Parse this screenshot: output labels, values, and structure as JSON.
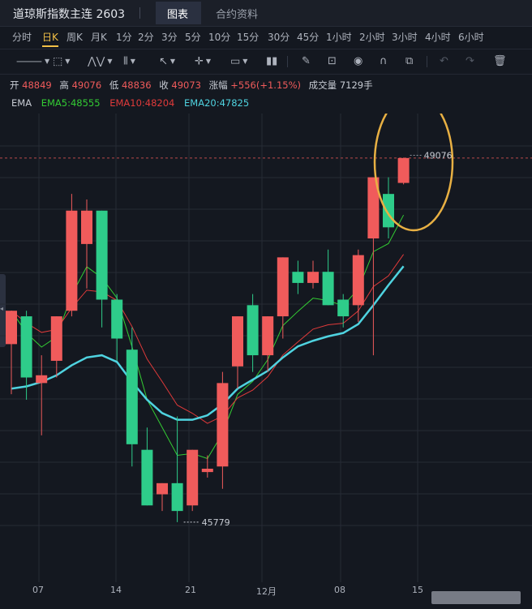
{
  "header": {
    "title": "道琼斯指数主连 2603",
    "tabs": [
      {
        "label": "图表",
        "active": true
      },
      {
        "label": "合约资料",
        "active": false
      }
    ]
  },
  "periods": [
    "分时",
    "日K",
    "周K",
    "月K",
    "1分",
    "2分",
    "3分",
    "5分",
    "10分",
    "15分",
    "30分",
    "45分",
    "1小时",
    "2小时",
    "3小时",
    "4小时",
    "6小时"
  ],
  "active_period": "日K",
  "toolbar": {
    "icons": [
      "line-tool-icon",
      "rect-tool-icon",
      "wave-tool-icon",
      "channel-tool-icon",
      "arrow-tool-icon",
      "cross-tool-icon",
      "text-tool-icon",
      "indicator-icon",
      "pen-icon",
      "lock-icon",
      "eye-icon",
      "magnet-icon",
      "layers-icon",
      "undo-icon",
      "redo-icon",
      "trash-icon"
    ]
  },
  "ohlc": {
    "open_label": "开",
    "open": "48849",
    "high_label": "高",
    "high": "49076",
    "low_label": "低",
    "low": "48836",
    "close_label": "收",
    "close": "49073",
    "change_label": "涨幅",
    "change": "+556(+1.15%)",
    "volume_label": "成交量",
    "volume": "7129手"
  },
  "ema": {
    "label": "EMA",
    "ema5": "EMA5:48555",
    "ema10": "EMA10:48204",
    "ema20": "EMA20:47825",
    "colors": {
      "ema5": "#33cc33",
      "ema10": "#e03a3a",
      "ema20": "#4fd3e0"
    }
  },
  "colors": {
    "up": "#f05b5b",
    "down": "#2ecc8a",
    "ema20": "#4fd3e0"
  },
  "chart_data": {
    "type": "candlestick",
    "x_ticks": [
      "07",
      "14",
      "21",
      "12月",
      "08",
      "15"
    ],
    "y_range": [
      45500,
      49400
    ],
    "price_markers": {
      "high": "49076",
      "low": "45779"
    },
    "candles": [
      {
        "o": 47400,
        "h": 47650,
        "l": 46950,
        "c": 47700
      },
      {
        "o": 47650,
        "h": 47700,
        "l": 46900,
        "c": 47100
      },
      {
        "o": 47050,
        "h": 47300,
        "l": 46580,
        "c": 47120
      },
      {
        "o": 47250,
        "h": 47600,
        "l": 47100,
        "c": 47650
      },
      {
        "o": 47700,
        "h": 48750,
        "l": 47650,
        "c": 48600
      },
      {
        "o": 48300,
        "h": 48700,
        "l": 47900,
        "c": 48600
      },
      {
        "o": 48600,
        "h": 48600,
        "l": 47550,
        "c": 47800
      },
      {
        "o": 47800,
        "h": 47850,
        "l": 47250,
        "c": 47450
      },
      {
        "o": 47350,
        "h": 47550,
        "l": 46300,
        "c": 46500
      },
      {
        "o": 46450,
        "h": 46650,
        "l": 45950,
        "c": 45950
      },
      {
        "o": 46050,
        "h": 46100,
        "l": 45900,
        "c": 46150
      },
      {
        "o": 46150,
        "h": 46750,
        "l": 45800,
        "c": 45900
      },
      {
        "o": 45950,
        "h": 46450,
        "l": 45900,
        "c": 46450
      },
      {
        "o": 46250,
        "h": 46400,
        "l": 46200,
        "c": 46280
      },
      {
        "o": 46300,
        "h": 47150,
        "l": 46100,
        "c": 47050
      },
      {
        "o": 47200,
        "h": 47650,
        "l": 47000,
        "c": 47650
      },
      {
        "o": 47750,
        "h": 47850,
        "l": 47150,
        "c": 47300
      },
      {
        "o": 47300,
        "h": 47650,
        "l": 47150,
        "c": 47650
      },
      {
        "o": 47650,
        "h": 47950,
        "l": 47450,
        "c": 48180
      },
      {
        "o": 48050,
        "h": 48150,
        "l": 47850,
        "c": 47950
      },
      {
        "o": 47950,
        "h": 48150,
        "l": 47900,
        "c": 48050
      },
      {
        "o": 48050,
        "h": 48250,
        "l": 47800,
        "c": 47750
      },
      {
        "o": 47800,
        "h": 47850,
        "l": 47550,
        "c": 47650
      },
      {
        "o": 47750,
        "h": 48250,
        "l": 47600,
        "c": 48200
      },
      {
        "o": 48350,
        "h": 48850,
        "l": 47300,
        "c": 48900
      },
      {
        "o": 48750,
        "h": 48900,
        "l": 48350,
        "c": 48450
      },
      {
        "o": 48849,
        "h": 49076,
        "l": 48836,
        "c": 49073
      }
    ],
    "ema20": [
      47000,
      47020,
      47060,
      47120,
      47210,
      47280,
      47300,
      47240,
      47060,
      46900,
      46780,
      46720,
      46720,
      46760,
      46860,
      47000,
      47080,
      47160,
      47280,
      47380,
      47430,
      47470,
      47500,
      47580,
      47750,
      47930,
      48100
    ]
  }
}
